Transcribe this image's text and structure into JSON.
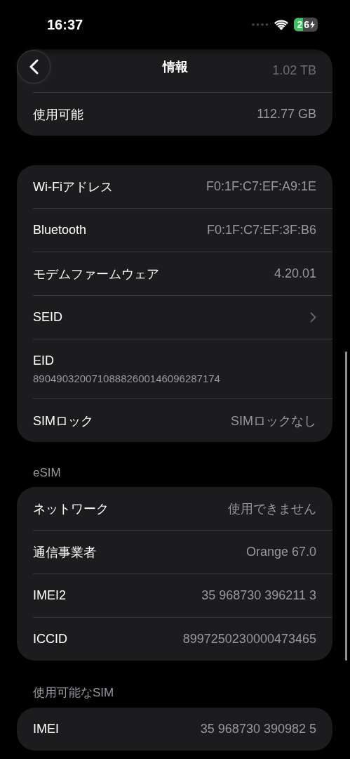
{
  "status_bar": {
    "time": "16:37",
    "battery": "26"
  },
  "nav": {
    "title": "情報"
  },
  "sections": [
    {
      "rows": [
        {
          "kind": "value",
          "label": "",
          "value": "1.02 TB"
        },
        {
          "kind": "value",
          "label": "使用可能",
          "value": "112.77 GB"
        }
      ]
    },
    {
      "rows": [
        {
          "kind": "value",
          "label": "Wi-Fiアドレス",
          "value": "F0:1F:C7:EF:A9:1E"
        },
        {
          "kind": "value",
          "label": "Bluetooth",
          "value": "F0:1F:C7:EF:3F:B6"
        },
        {
          "kind": "value",
          "label": "モデムファームウェア",
          "value": "4.20.01"
        },
        {
          "kind": "chevron",
          "label": "SEID"
        },
        {
          "kind": "stacked",
          "label": "EID",
          "value": "89049032007108882600146096287174"
        },
        {
          "kind": "value",
          "label": "SIMロック",
          "value": "SIMロックなし"
        }
      ]
    },
    {
      "header": "eSIM",
      "rows": [
        {
          "kind": "value",
          "label": "ネットワーク",
          "value": "使用できません"
        },
        {
          "kind": "value",
          "label": "通信事業者",
          "value": "Orange 67.0"
        },
        {
          "kind": "value",
          "label": "IMEI2",
          "value": "35 968730 396211 3"
        },
        {
          "kind": "value",
          "label": "ICCID",
          "value": "8997250230000473465"
        }
      ]
    },
    {
      "header": "使用可能なSIM",
      "rows": [
        {
          "kind": "value",
          "label": "IMEI",
          "value": "35 968730 390982 5"
        }
      ]
    }
  ]
}
